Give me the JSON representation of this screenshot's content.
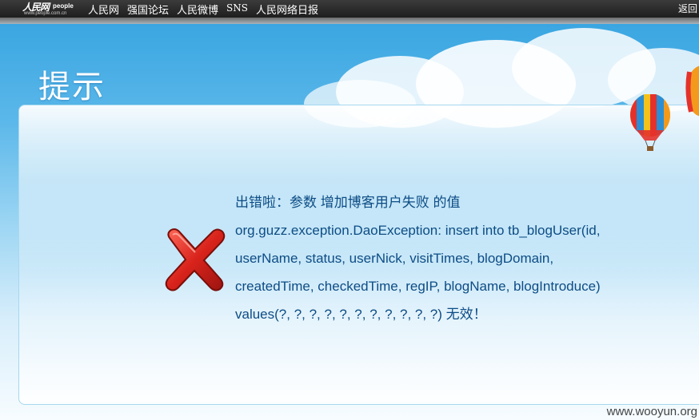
{
  "header": {
    "logo_brand": "人民网",
    "logo_brand_en": "people",
    "logo_url": "www.people.com.cn",
    "nav": [
      "人民网",
      "强国论坛",
      "人民微博",
      "SNS",
      "人民网络日报"
    ],
    "back_label": "返回"
  },
  "page": {
    "title": "提示"
  },
  "error": {
    "icon": "red-x-icon",
    "lines": [
      "出错啦：参数 增加博客用户失败 的值",
      "org.guzz.exception.DaoException: insert into tb_blogUser(id,",
      "userName, status, userNick, visitTimes, blogDomain,",
      "createdTime, checkedTime, regIP, blogName, blogIntroduce)",
      "values(?, ?, ?, ?, ?, ?, ?, ?, ?, ?, ?) 无效！"
    ]
  },
  "watermark": "www.wooyun.org",
  "colors": {
    "topbar": "#2b2b2b",
    "sky": "#3aa6e1",
    "message_text": "#0d4c85",
    "error_icon": "#d0201a"
  }
}
